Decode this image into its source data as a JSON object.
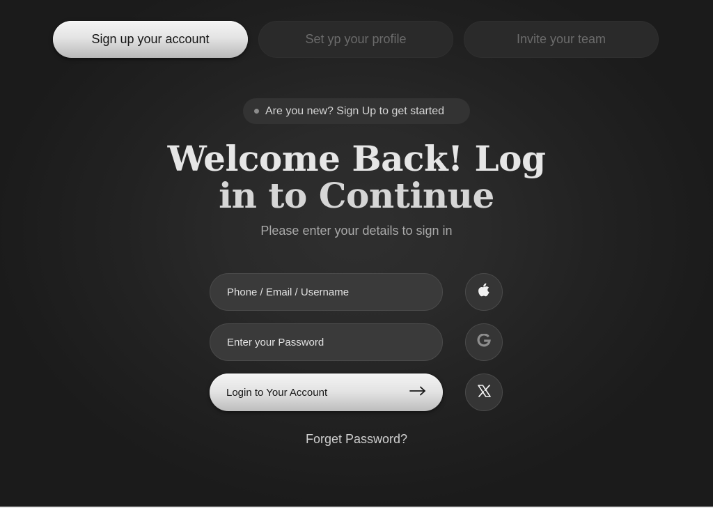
{
  "steps": [
    {
      "label": "Sign up your account",
      "state": "active"
    },
    {
      "label": "Set yp your profile",
      "state": "inactive"
    },
    {
      "label": "Invite your team",
      "state": "inactive"
    }
  ],
  "badge": {
    "text": "Are you new? Sign Up to get started"
  },
  "heading": {
    "line1": "Welcome Back! Log",
    "line2": "in to Continue"
  },
  "subtitle": "Please enter your details to sign in",
  "form": {
    "identifier_placeholder": "Phone / Email / Username",
    "password_placeholder": "Enter your Password",
    "login_label": "Login to Your Account"
  },
  "social": [
    {
      "icon": "apple-icon"
    },
    {
      "icon": "google-icon"
    },
    {
      "icon": "x-icon"
    }
  ],
  "forgot_password": "Forget Password?",
  "colors": {
    "background": "#1b1b1b",
    "active_step": "#e4e4e4",
    "inactive_step": "#2a2a2a",
    "input_bg": "#3a3a3a"
  }
}
